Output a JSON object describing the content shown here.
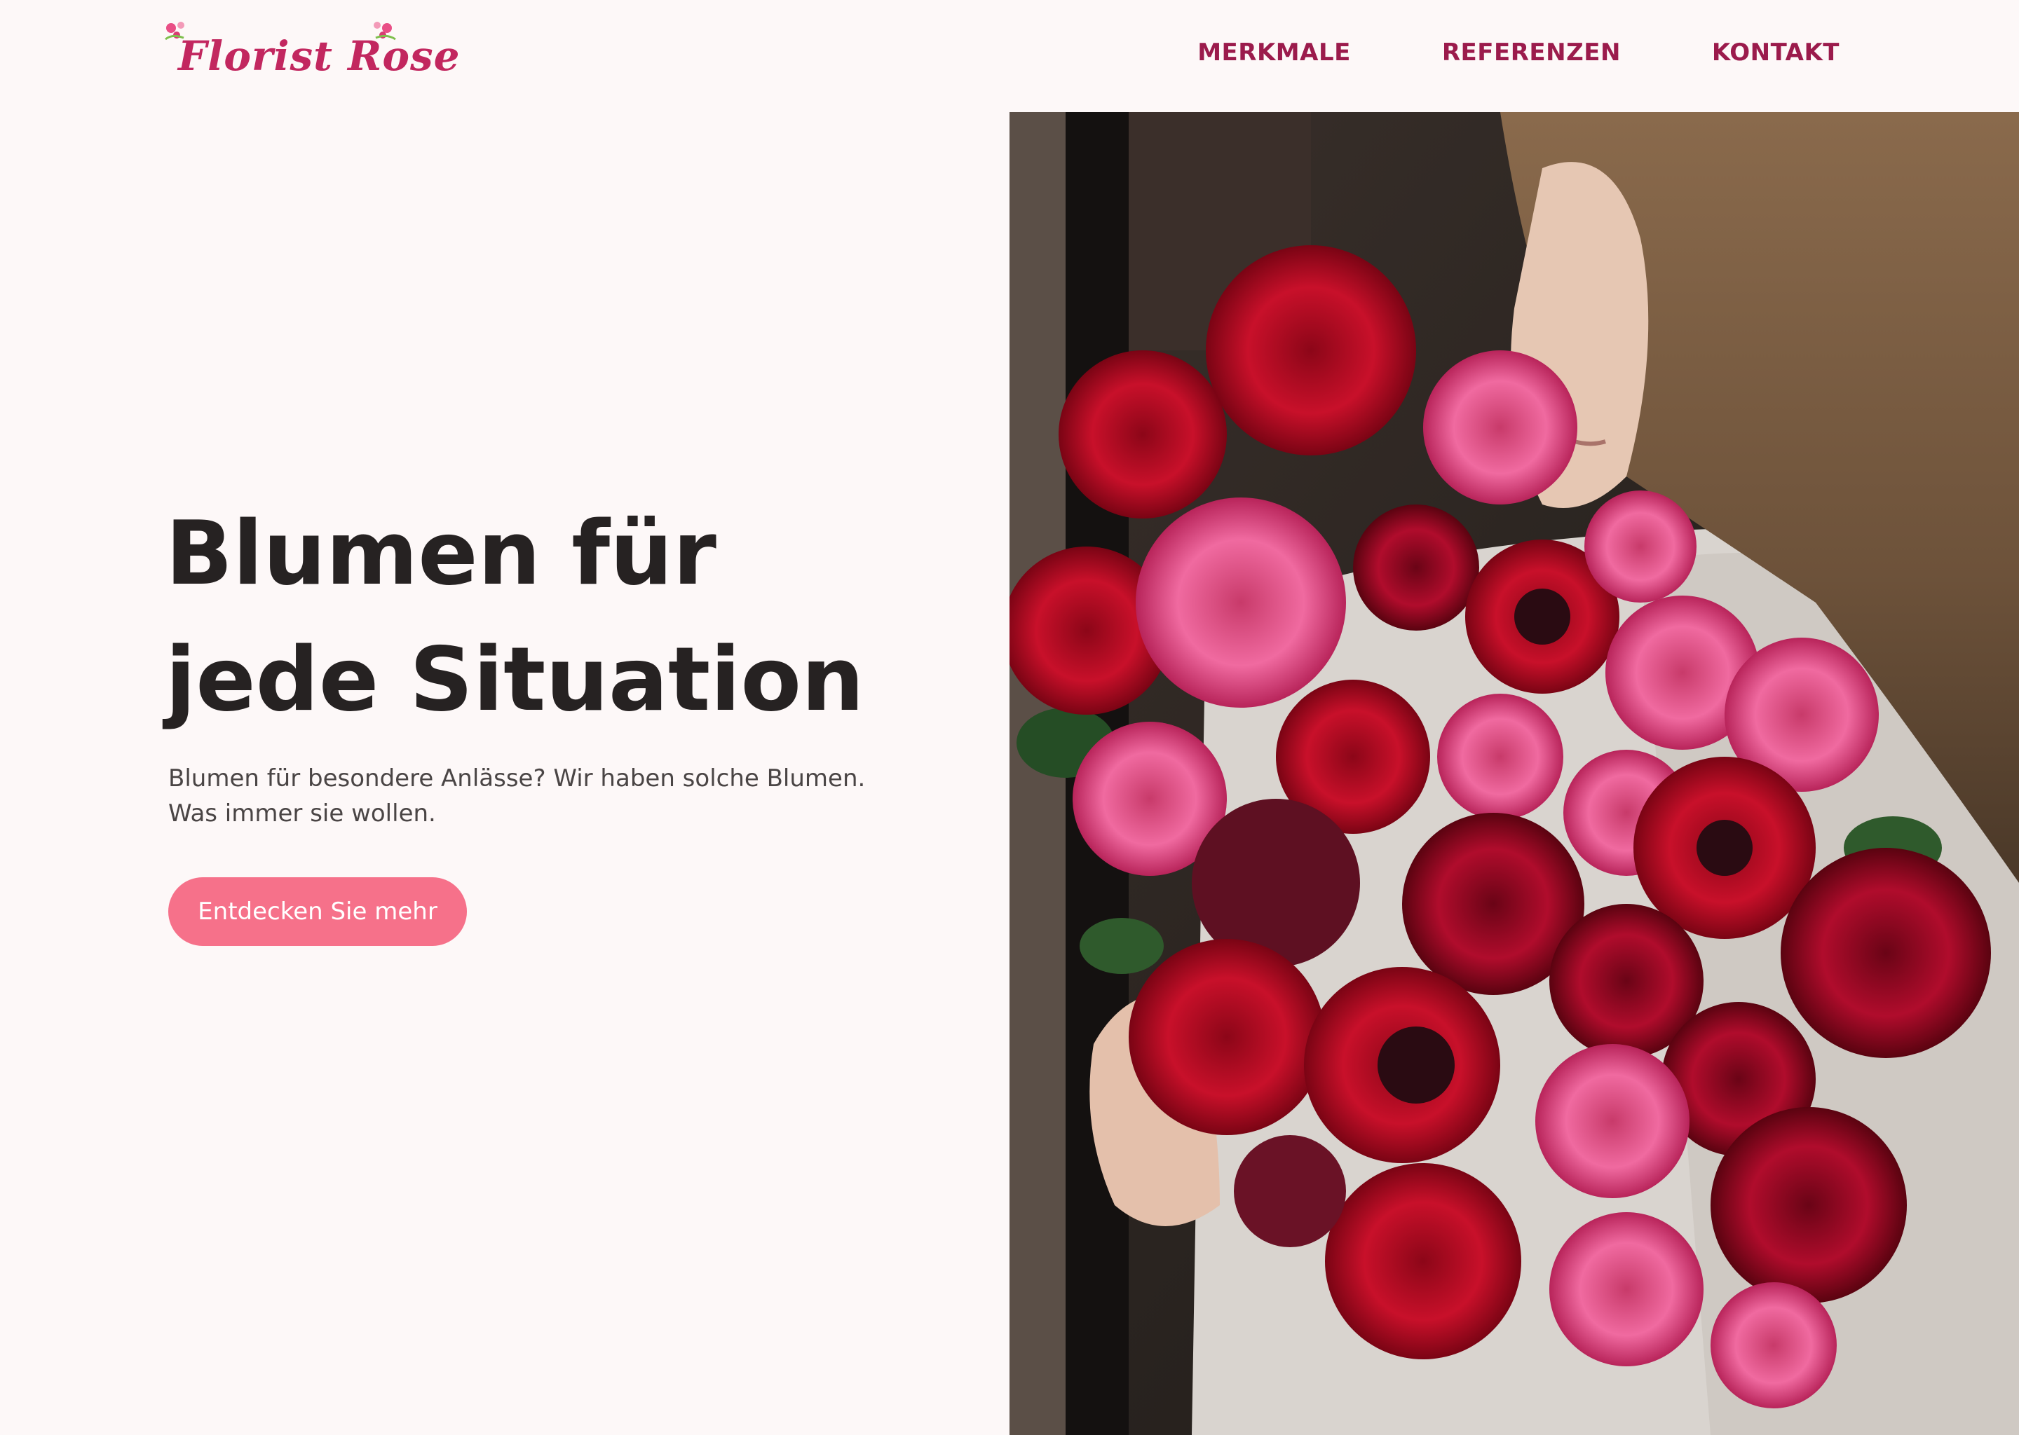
{
  "brand": {
    "name": "Florist Rose"
  },
  "nav": {
    "items": [
      {
        "label": "MERKMALE"
      },
      {
        "label": "REFERENZEN"
      },
      {
        "label": "KONTAKT"
      }
    ]
  },
  "hero": {
    "title_line1": "Blumen für",
    "title_line2": "jede Situation",
    "subtitle_line1": "Blumen für besondere Anlässe? Wir haben solche Blumen.",
    "subtitle_line2": "Was immer sie wollen.",
    "cta_label": "Entdecken Sie mehr",
    "image_icon": "rose-bouquet-photo"
  },
  "colors": {
    "background": "#fdf8f8",
    "brand": "#c2275f",
    "nav": "#9b1b4c",
    "heading": "#262222",
    "body_text": "#4a4545",
    "cta": "#f6718a"
  }
}
